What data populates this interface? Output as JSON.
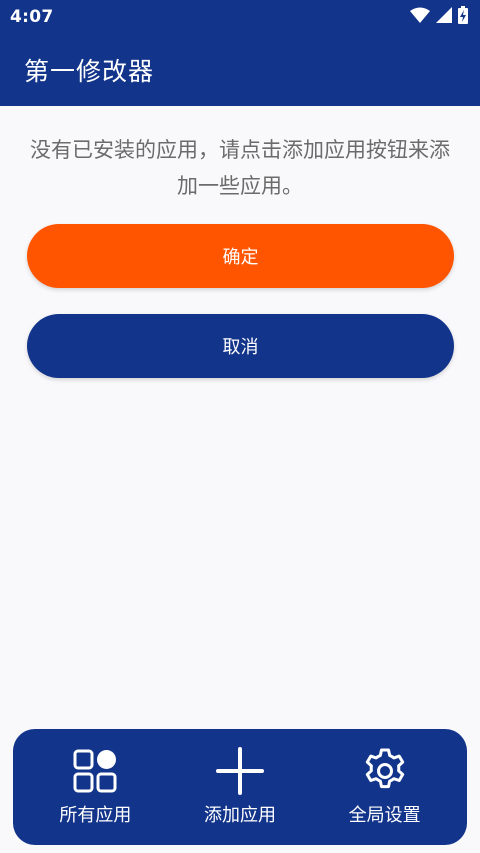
{
  "status_bar": {
    "time": "4:07",
    "icons": [
      "wifi-icon",
      "signal-icon",
      "battery-charging-icon"
    ]
  },
  "app_bar": {
    "title": "第一修改器"
  },
  "main": {
    "empty_message": "没有已安装的应用，请点击添加应用按钮来添加一些应用。",
    "confirm_label": "确定",
    "cancel_label": "取消"
  },
  "bottom_nav": {
    "items": [
      {
        "label": "所有应用",
        "icon": "apps-grid-icon"
      },
      {
        "label": "添加应用",
        "icon": "plus-icon"
      },
      {
        "label": "全局设置",
        "icon": "gear-icon"
      }
    ]
  },
  "colors": {
    "primary": "#12348a",
    "accent": "#ff5500",
    "background": "#f9f9fb",
    "message_text": "#6b6b6b"
  }
}
